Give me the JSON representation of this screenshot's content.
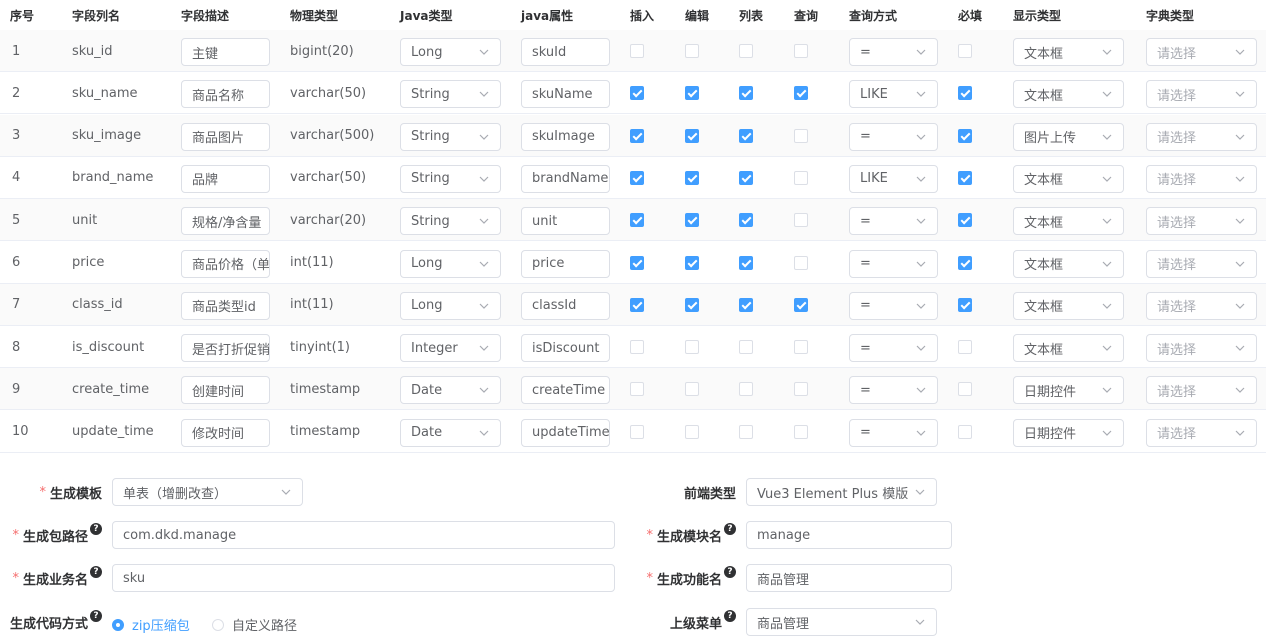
{
  "columns": {
    "seq": "序号",
    "column_name": "字段列名",
    "column_desc": "字段描述",
    "physical_type": "物理类型",
    "java_type": "Java类型",
    "java_field": "java属性",
    "insert": "插入",
    "edit": "编辑",
    "list": "列表",
    "query": "查询",
    "query_mode": "查询方式",
    "required": "必填",
    "display_type": "显示类型",
    "dict_type": "字典类型"
  },
  "rows": [
    {
      "seq": "1",
      "column_name": "sku_id",
      "column_desc": "主键",
      "physical_type": "bigint(20)",
      "java_type": "Long",
      "java_field": "skuId",
      "insert": false,
      "edit": false,
      "list": false,
      "query": false,
      "query_mode": "=",
      "required": false,
      "display_type": "文本框",
      "dict_type": "请选择"
    },
    {
      "seq": "2",
      "column_name": "sku_name",
      "column_desc": "商品名称",
      "physical_type": "varchar(50)",
      "java_type": "String",
      "java_field": "skuName",
      "insert": true,
      "edit": true,
      "list": true,
      "query": true,
      "query_mode": "LIKE",
      "required": true,
      "display_type": "文本框",
      "dict_type": "请选择"
    },
    {
      "seq": "3",
      "column_name": "sku_image",
      "column_desc": "商品图片",
      "physical_type": "varchar(500)",
      "java_type": "String",
      "java_field": "skuImage",
      "insert": true,
      "edit": true,
      "list": true,
      "query": false,
      "query_mode": "=",
      "required": true,
      "display_type": "图片上传",
      "dict_type": "请选择"
    },
    {
      "seq": "4",
      "column_name": "brand_name",
      "column_desc": "品牌",
      "physical_type": "varchar(50)",
      "java_type": "String",
      "java_field": "brandName",
      "insert": true,
      "edit": true,
      "list": true,
      "query": false,
      "query_mode": "LIKE",
      "required": true,
      "display_type": "文本框",
      "dict_type": "请选择"
    },
    {
      "seq": "5",
      "column_name": "unit",
      "column_desc": "规格/净含量",
      "physical_type": "varchar(20)",
      "java_type": "String",
      "java_field": "unit",
      "insert": true,
      "edit": true,
      "list": true,
      "query": false,
      "query_mode": "=",
      "required": true,
      "display_type": "文本框",
      "dict_type": "请选择"
    },
    {
      "seq": "6",
      "column_name": "price",
      "column_desc": "商品价格（单",
      "physical_type": "int(11)",
      "java_type": "Long",
      "java_field": "price",
      "insert": true,
      "edit": true,
      "list": true,
      "query": false,
      "query_mode": "=",
      "required": true,
      "display_type": "文本框",
      "dict_type": "请选择"
    },
    {
      "seq": "7",
      "column_name": "class_id",
      "column_desc": "商品类型id",
      "physical_type": "int(11)",
      "java_type": "Long",
      "java_field": "classId",
      "insert": true,
      "edit": true,
      "list": true,
      "query": true,
      "query_mode": "=",
      "required": true,
      "display_type": "文本框",
      "dict_type": "请选择"
    },
    {
      "seq": "8",
      "column_name": "is_discount",
      "column_desc": "是否打折促销",
      "physical_type": "tinyint(1)",
      "java_type": "Integer",
      "java_field": "isDiscount",
      "insert": false,
      "edit": false,
      "list": false,
      "query": false,
      "query_mode": "=",
      "required": false,
      "display_type": "文本框",
      "dict_type": "请选择"
    },
    {
      "seq": "9",
      "column_name": "create_time",
      "column_desc": "创建时间",
      "physical_type": "timestamp",
      "java_type": "Date",
      "java_field": "createTime",
      "insert": false,
      "edit": false,
      "list": false,
      "query": false,
      "query_mode": "=",
      "required": false,
      "display_type": "日期控件",
      "dict_type": "请选择"
    },
    {
      "seq": "10",
      "column_name": "update_time",
      "column_desc": "修改时间",
      "physical_type": "timestamp",
      "java_type": "Date",
      "java_field": "updateTime",
      "insert": false,
      "edit": false,
      "list": false,
      "query": false,
      "query_mode": "=",
      "required": false,
      "display_type": "日期控件",
      "dict_type": "请选择"
    }
  ],
  "form": {
    "required_mark": "*",
    "help_glyph": "?",
    "template": {
      "label": "生成模板",
      "value": "单表（增删改查）"
    },
    "frontend_type": {
      "label": "前端类型",
      "value": "Vue3 Element Plus 模版"
    },
    "package_path": {
      "label": "生成包路径",
      "value": "com.dkd.manage"
    },
    "module_name": {
      "label": "生成模块名",
      "value": "manage"
    },
    "business_name": {
      "label": "生成业务名",
      "value": "sku"
    },
    "function_name": {
      "label": "生成功能名",
      "value": "商品管理"
    },
    "gen_type": {
      "label": "生成代码方式",
      "options": [
        "zip压缩包",
        "自定义路径"
      ],
      "selected": "zip压缩包"
    },
    "parent_menu": {
      "label": "上级菜单",
      "value": "商品管理"
    }
  },
  "colors": {
    "primary": "#409eff",
    "required": "#f56c6c",
    "border": "#dcdfe6"
  }
}
